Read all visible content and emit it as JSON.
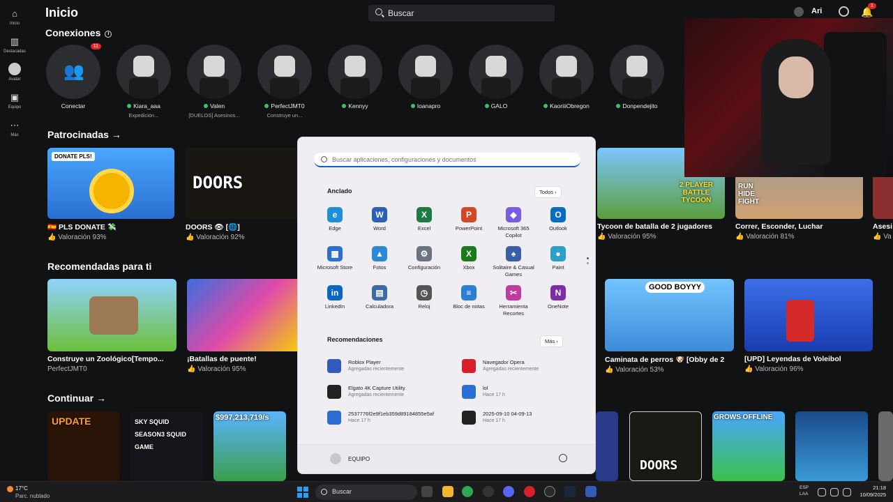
{
  "nav": {
    "items": [
      {
        "label": "Inicio",
        "icon": "home-icon"
      },
      {
        "label": "Destacadas",
        "icon": "chart-icon"
      },
      {
        "label": "Avatar",
        "icon": "avatar-icon"
      },
      {
        "label": "Equipo",
        "icon": "inventory-icon"
      },
      {
        "label": "Más",
        "icon": "more-icon"
      }
    ]
  },
  "header": {
    "title": "Inicio",
    "search_placeholder": "Buscar",
    "user": "Ari",
    "notif_count": "1"
  },
  "connections": {
    "title": "Conexiones",
    "friends": [
      {
        "name": "Conectar",
        "status": "",
        "badge": "11",
        "online": false
      },
      {
        "name": "Kiara_aaa",
        "status": "Expedición...",
        "online": true
      },
      {
        "name": "Valen",
        "status": "[DUELOS] Asesinos...",
        "online": true
      },
      {
        "name": "PerfectJMT0",
        "status": "Construye un...",
        "online": true
      },
      {
        "name": "Kennyy",
        "status": "",
        "online": true
      },
      {
        "name": "Ioanapro",
        "status": "",
        "online": true
      },
      {
        "name": "GALO",
        "status": "",
        "online": true
      },
      {
        "name": "KaoriiiObregon",
        "status": "",
        "online": true
      },
      {
        "name": "Donpendejito",
        "status": "",
        "online": true
      }
    ]
  },
  "sponsored": {
    "title": "Patrocinadas",
    "arrow": "→",
    "games": [
      {
        "title": "PLS DONATE 💸",
        "flag": "🇪🇸",
        "rating": "Valoración 93%",
        "thumb_text": "DONATE PLS!"
      },
      {
        "title": "DOORS 👁 [🌐]",
        "rating": "Valoración 92%",
        "thumb_text": "DOORS"
      },
      {
        "title": "Tycoon de batalla de 2 jugadores",
        "rating": "Valoración 95%",
        "thumb_text": "2 PLAYER BATTLE TYCOON"
      },
      {
        "title": "Correr, Esconder, Luchar",
        "rating": "Valoración 81%",
        "thumb_text": "RUN HIDE FIGHT"
      },
      {
        "title": "Asesi",
        "rating": "Va",
        "thumb_text": ""
      }
    ]
  },
  "recommended": {
    "title": "Recomendadas para ti",
    "games": [
      {
        "title": "Construye un Zoológico[Tempo...",
        "rating": "PerfectJMT0"
      },
      {
        "title": "¡Batallas de puente!",
        "rating": "Valoración 95%"
      },
      {
        "title": "Caminata de perros 🐶 [Obby de 2",
        "rating": "Valoración 53%",
        "thumb_text": "GOOD BOYYY"
      },
      {
        "title": "[UPD] Leyendas de Voleibol",
        "rating": "Valoración 96%"
      }
    ]
  },
  "continue": {
    "title": "Continuar",
    "games": [
      {
        "thumb_text": "UPDATE"
      },
      {
        "thumb_text": "SKY SQUID SEASON3 SQUID GAME"
      },
      {
        "thumb_text": "$997,213,719/s"
      },
      {
        "thumb_text": ""
      },
      {
        "thumb_text": "DOORS"
      },
      {
        "thumb_text": "GROWS OFFLINE"
      },
      {
        "thumb_text": ""
      }
    ]
  },
  "start_menu": {
    "search_placeholder": "Buscar aplicaciones, configuraciones y documentos",
    "pinned_title": "Anclado",
    "all_button": "Todos",
    "pinned": [
      {
        "label": "Edge",
        "color": "#1f8fd8",
        "glyph": "e"
      },
      {
        "label": "Word",
        "color": "#2b5fb8",
        "glyph": "W"
      },
      {
        "label": "Excel",
        "color": "#1e7b45",
        "glyph": "X"
      },
      {
        "label": "PowerPoint",
        "color": "#d24726",
        "glyph": "P"
      },
      {
        "label": "Microsoft 365 Copilot",
        "color": "#7a5ce0",
        "glyph": "◆"
      },
      {
        "label": "Outlook",
        "color": "#0b6cc4",
        "glyph": "O"
      },
      {
        "label": "Microsoft Store",
        "color": "#2a6fd1",
        "glyph": "▦"
      },
      {
        "label": "Fotos",
        "color": "#2a8ad8",
        "glyph": "▲"
      },
      {
        "label": "Configuración",
        "color": "#6b7380",
        "glyph": "⚙"
      },
      {
        "label": "Xbox",
        "color": "#187a18",
        "glyph": "X"
      },
      {
        "label": "Solitaire & Casual Games",
        "color": "#3a5fa8",
        "glyph": "♠"
      },
      {
        "label": "Paint",
        "color": "#2aa2c8",
        "glyph": "●"
      },
      {
        "label": "LinkedIn",
        "color": "#0a66c2",
        "glyph": "in"
      },
      {
        "label": "Calculadora",
        "color": "#3d6aa8",
        "glyph": "▤"
      },
      {
        "label": "Reloj",
        "color": "#555",
        "glyph": "◷"
      },
      {
        "label": "Bloc de notas",
        "color": "#2b7fd4",
        "glyph": "≡"
      },
      {
        "label": "Herramienta Recortes",
        "color": "#c03aa0",
        "glyph": "✂"
      },
      {
        "label": "OneNote",
        "color": "#7b2ea8",
        "glyph": "N"
      }
    ],
    "recs_title": "Recomendaciones",
    "more_button": "Más",
    "recommendations": [
      {
        "title": "Roblox Player",
        "sub": "Agregadas recientemente",
        "color": "#335bbb"
      },
      {
        "title": "Navegador Opera",
        "sub": "Agregadas recientemente",
        "color": "#d6202a"
      },
      {
        "title": "Elgato 4K Capture Utility",
        "sub": "Agregadas recientemente",
        "color": "#222"
      },
      {
        "title": "lol",
        "sub": "Hace 17 h",
        "color": "#2a6fd1"
      },
      {
        "title": "2537776f2e9f1eb359d89184855e5af",
        "sub": "Hace 17 h",
        "color": "#2a6fd1"
      },
      {
        "title": "2025-09-10 04-09-13",
        "sub": "Hace 17 h",
        "color": "#222"
      }
    ],
    "user": "EQUIPO"
  },
  "taskbar": {
    "temp": "17°C",
    "weather": "Parc. nublado",
    "search": "Buscar",
    "lang1": "ESP",
    "lang2": "LAA",
    "time": "21:18",
    "date": "10/09/2025"
  }
}
